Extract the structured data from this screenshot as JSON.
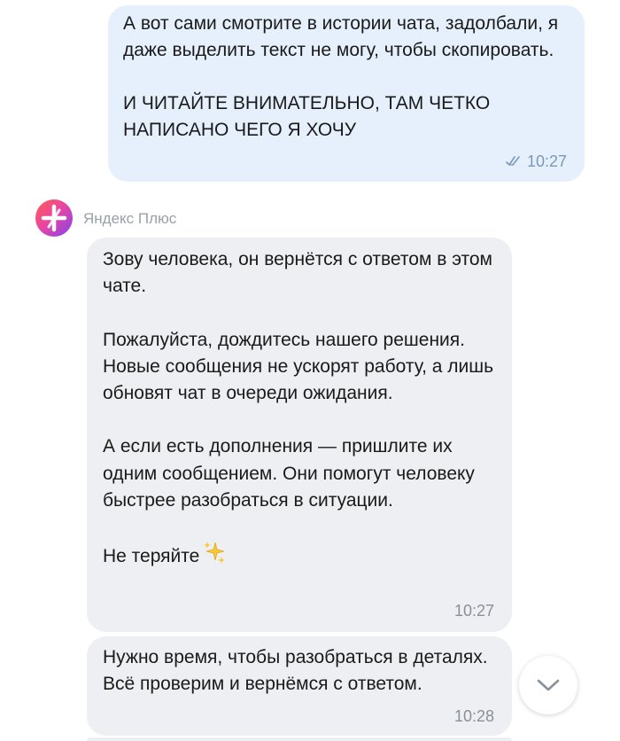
{
  "messages": {
    "outgoing": {
      "text": "А вот сами смотрите в истории чата, задолбали, я даже выделить текст не могу, чтобы скопировать.\n\nИ ЧИТАЙТЕ ВНИМАТЕЛЬНО, ТАМ ЧЕТКО НАПИСАНО ЧЕГО Я ХОЧУ",
      "time": "10:27",
      "status_icon": "double-check-icon"
    },
    "sender": {
      "name": "Яндекс Плюс",
      "avatar_icon": "yandex-plus-logo"
    },
    "incoming": [
      {
        "text": "Зову человека, он вернётся с ответом в этом чате.\n\nПожалуйста, дождитесь нашего решения. Новые сообщения не ускорят работу, а лишь обновят чат в очереди ожидания.\n\nА если есть дополнения — пришлите их одним сообщением. Они помогут человеку быстрее разобраться в ситуации.\n\nНе теряйте",
        "emoji_icon": "sparkles-icon",
        "time": "10:27"
      },
      {
        "text": "Нужно время, чтобы разобраться в деталях. Всё проверим и вернёмся с ответом.",
        "time": "10:28"
      }
    ]
  },
  "controls": {
    "scroll_down_icon": "chevron-down-icon"
  },
  "colors": {
    "outgoing_bubble": "#e6f0fc",
    "incoming_bubble": "#eeeff2",
    "outgoing_meta": "#7c98b8",
    "incoming_meta": "#8a9099"
  }
}
